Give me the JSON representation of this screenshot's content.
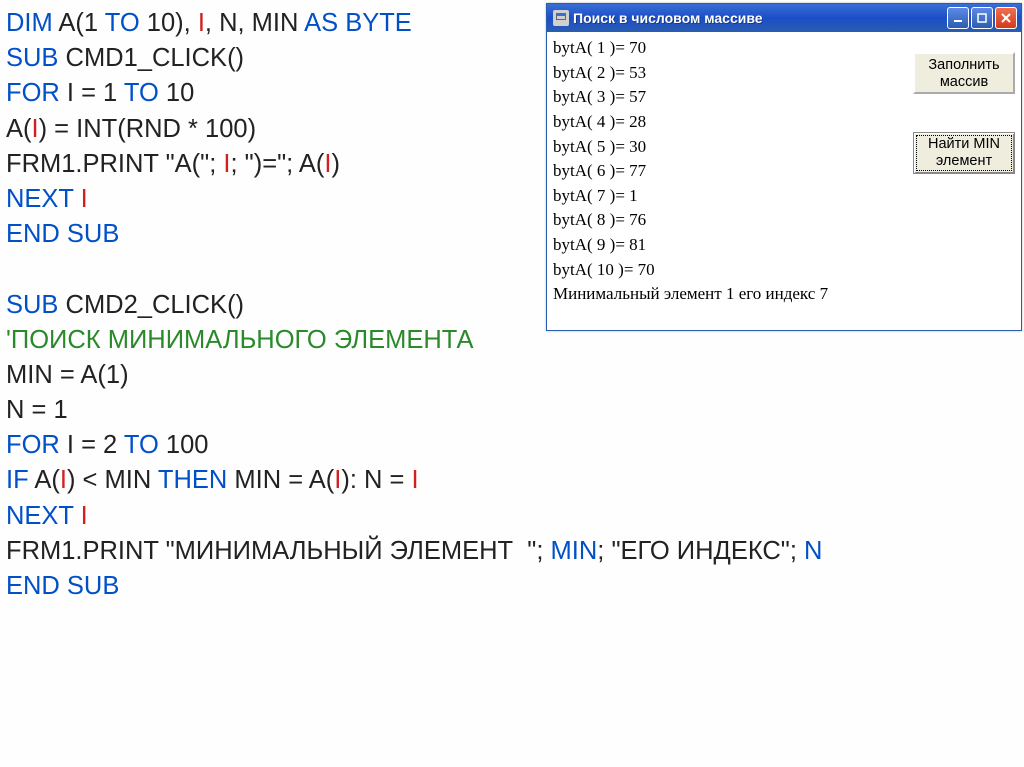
{
  "code": {
    "l1_dim": "DIM",
    "l1_rest1": " A(1 ",
    "l1_to": "TO",
    "l1_rest2": " 10), ",
    "l1_i": "I",
    "l1_rest3": ", N, MIN ",
    "l1_as": "AS BYTE",
    "l2_sub": "SUB",
    "l2_rest": " CMD1_CLICK()",
    "l3_for": "FOR",
    "l3_mid": " I = 1 ",
    "l3_to": "TO",
    "l3_end": " 10",
    "l4_a": "A(",
    "l4_i": "I",
    "l4_rest": ") = INT(RND * 100)",
    "l5_pre": "FRM1.PRINT \"A(\"; ",
    "l5_i": "I",
    "l5_mid": "; \")=\"; A(",
    "l5_i2": "I",
    "l5_end": ")",
    "l6_next": "NEXT",
    "l6_i": " I",
    "l7": "END SUB",
    "l8": " ",
    "l9_sub": "SUB",
    "l9_rest": " CMD2_CLICK()",
    "l10": "'ПОИСК МИНИМАЛЬНОГО ЭЛЕМЕНТА",
    "l11": "MIN = A(1)",
    "l12": "N = 1",
    "l13_for": "FOR",
    "l13_mid": " I = 2 ",
    "l13_to": "TO",
    "l13_end": " 100",
    "l14_if": "IF",
    "l14_a": " A(",
    "l14_i": "I",
    "l14_mid1": ") < MIN ",
    "l14_then": "THEN",
    "l14_mid2": " MIN = A(",
    "l14_i2": "I",
    "l14_end": "): N = ",
    "l14_i3": "I",
    "l15_next": "NEXT",
    "l15_i": " I",
    "l16_pre": "FRM1.PRINT \"МИНИМАЛЬНЫЙ ЭЛЕМЕНТ  \"; ",
    "l16_min": "MIN",
    "l16_mid": "; \"ЕГО ИНДЕКС\"; ",
    "l16_n": "N",
    "l17": "END SUB"
  },
  "window": {
    "title": "Поиск в числовом массиве",
    "buttons": {
      "fill_line1": "Заполнить",
      "fill_line2": "массив",
      "findmin_line1": "Найти MIN",
      "findmin_line2": "элемент"
    },
    "output": [
      "bytA( 1 )= 70",
      "bytA( 2 )= 53",
      "bytA( 3 )= 57",
      "bytA( 4 )= 28",
      "bytA( 5 )= 30",
      "bytA( 6 )= 77",
      "bytA( 7 )= 1",
      "bytA( 8 )= 76",
      "bytA( 9 )= 81",
      "bytA( 10 )= 70",
      "Минимальный элемент   1 его индекс 7"
    ]
  }
}
